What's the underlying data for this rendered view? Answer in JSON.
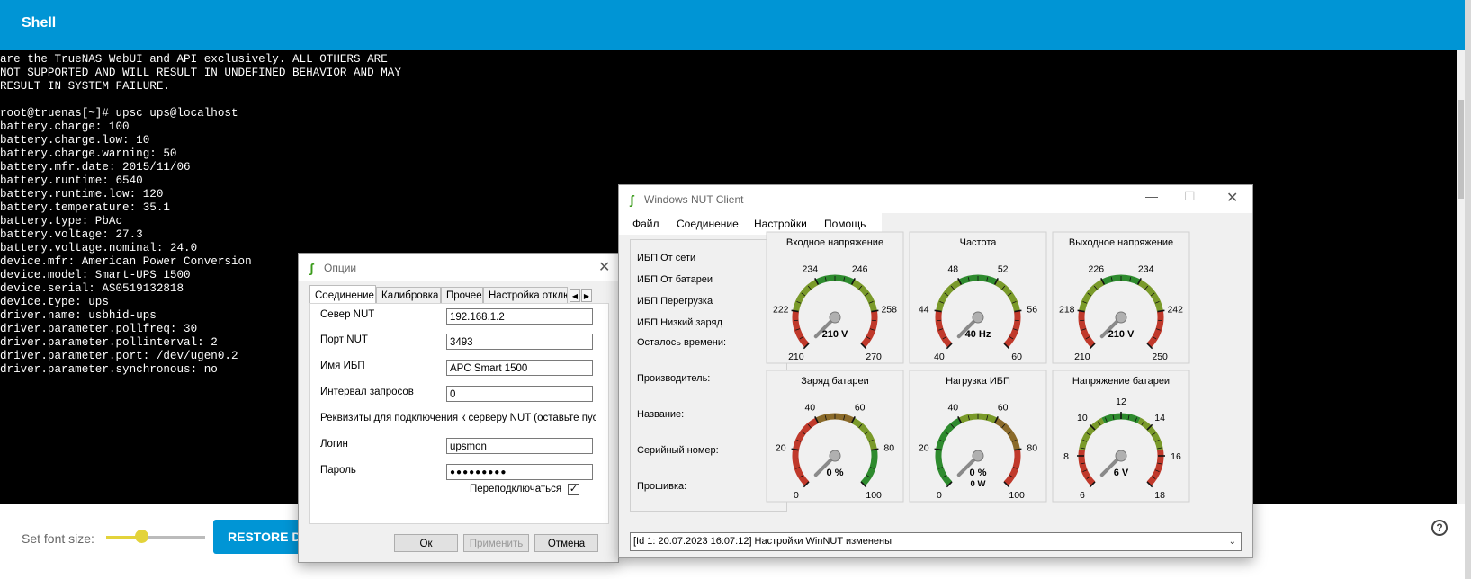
{
  "header": {
    "title": "Shell"
  },
  "terminal": {
    "lines": [
      "are the TrueNAS WebUI and API exclusively. ALL OTHERS ARE",
      "NOT SUPPORTED AND WILL RESULT IN UNDEFINED BEHAVIOR AND MAY",
      "RESULT IN SYSTEM FAILURE.",
      "",
      "root@truenas[~]# upsc ups@localhost",
      "battery.charge: 100",
      "battery.charge.low: 10",
      "battery.charge.warning: 50",
      "battery.mfr.date: 2015/11/06",
      "battery.runtime: 6540",
      "battery.runtime.low: 120",
      "battery.temperature: 35.1",
      "battery.type: PbAc",
      "battery.voltage: 27.3",
      "battery.voltage.nominal: 24.0",
      "device.mfr: American Power Conversion",
      "device.model: Smart-UPS 1500",
      "device.serial: AS0519132818",
      "device.type: ups",
      "driver.name: usbhid-ups",
      "driver.parameter.pollfreq: 30",
      "driver.parameter.pollinterval: 2",
      "driver.parameter.port: /dev/ugen0.2",
      "driver.parameter.synchronous: no"
    ]
  },
  "bottom": {
    "font_size_label": "Set font size:",
    "font_size_level": 0.35,
    "restore_label": "RESTORE DEFAULT",
    "help_icon": "?"
  },
  "options_dialog": {
    "logo": "ʃ",
    "title": "Опции",
    "close": "✕",
    "tabs": [
      "Соединение",
      "Калибровка",
      "Прочее",
      "Настройка отключения"
    ],
    "tab_prev": "◀",
    "tab_next": "▶",
    "fields": [
      {
        "label": "Север NUT",
        "value": "192.168.1.2"
      },
      {
        "label": "Порт NUT",
        "value": "3493"
      },
      {
        "label": "Имя ИБП",
        "value": "APC Smart 1500"
      },
      {
        "label": "Интервал запросов",
        "value": "0"
      }
    ],
    "credentials_note": "Реквизиты для подключения к серверу NUT (оставьте пустыми",
    "login_label": "Логин",
    "login_value": "upsmon",
    "password_label": "Пароль",
    "password_value": "●●●●●●●●●",
    "reconnect_label": "Переподключаться",
    "reconnect_checked": true,
    "check_mark": "✓",
    "buttons": {
      "ok": "Ок",
      "apply": "Применить",
      "cancel": "Отмена"
    }
  },
  "nut_client": {
    "logo": "ʃ",
    "title": "Windows NUT Client",
    "controls": {
      "minimize": "—",
      "maximize": "☐",
      "close": "✕"
    },
    "menu": [
      "Файл",
      "Соединение",
      "Настройки",
      "Помощь"
    ],
    "status_checks": [
      "ИБП От сети",
      "ИБП От батареи",
      "ИБП Перегрузка",
      "ИБП Низкий заряд"
    ],
    "info_labels": [
      "Осталось времени:",
      "Производитель:",
      "Название:",
      "Серийный номер:",
      "Прошивка:"
    ],
    "gauges": [
      {
        "title": "Входное напряжение",
        "min": 210,
        "max": 270,
        "value": 210,
        "display": "210 V",
        "labels": [
          "210",
          "222",
          "234",
          "246",
          "258",
          "270"
        ],
        "zones": [
          "#c0392b",
          "#7a9a2a",
          "#2e8b2e",
          "#7a9a2a",
          "#c0392b"
        ]
      },
      {
        "title": "Частота",
        "min": 40,
        "max": 60,
        "value": 40,
        "display": "40 Hz",
        "labels": [
          "40",
          "44",
          "48",
          "52",
          "56",
          "60"
        ],
        "zones": [
          "#c0392b",
          "#7a9a2a",
          "#2e8b2e",
          "#7a9a2a",
          "#c0392b"
        ]
      },
      {
        "title": "Выходное напряжение",
        "min": 210,
        "max": 250,
        "value": 210,
        "display": "210 V",
        "labels": [
          "210",
          "218",
          "226",
          "234",
          "242",
          "250"
        ],
        "zones": [
          "#c0392b",
          "#7a9a2a",
          "#2e8b2e",
          "#7a9a2a",
          "#c0392b"
        ]
      },
      {
        "title": "Заряд батареи",
        "min": 0,
        "max": 100,
        "value": 0,
        "display": "0 %",
        "labels": [
          "0",
          "20",
          "40",
          "60",
          "80",
          "100"
        ],
        "zones": [
          "#c0392b",
          "#c0392b",
          "#8a6a2a",
          "#7a9a2a",
          "#2e8b2e"
        ]
      },
      {
        "title": "Нагрузка ИБП",
        "min": 0,
        "max": 100,
        "value": 0,
        "display": "0 %",
        "sub": "0 W",
        "labels": [
          "0",
          "20",
          "40",
          "60",
          "80",
          "100"
        ],
        "zones": [
          "#2e8b2e",
          "#2e8b2e",
          "#7a9a2a",
          "#8a6a2a",
          "#c0392b"
        ]
      },
      {
        "title": "Напряжение батареи",
        "min": 6,
        "max": 18,
        "value": 6,
        "display": "6 V",
        "labels": [
          "6",
          "8",
          "10",
          "12",
          "14",
          "16",
          "18"
        ],
        "zones": [
          "#c0392b",
          "#7a9a2a",
          "#2e8b2e",
          "#7a9a2a",
          "#c0392b"
        ]
      }
    ],
    "status_text": "[Id 1: 20.07.2023 16:07:12] Настройки WinNUT изменены",
    "status_arrow": "⌄"
  }
}
